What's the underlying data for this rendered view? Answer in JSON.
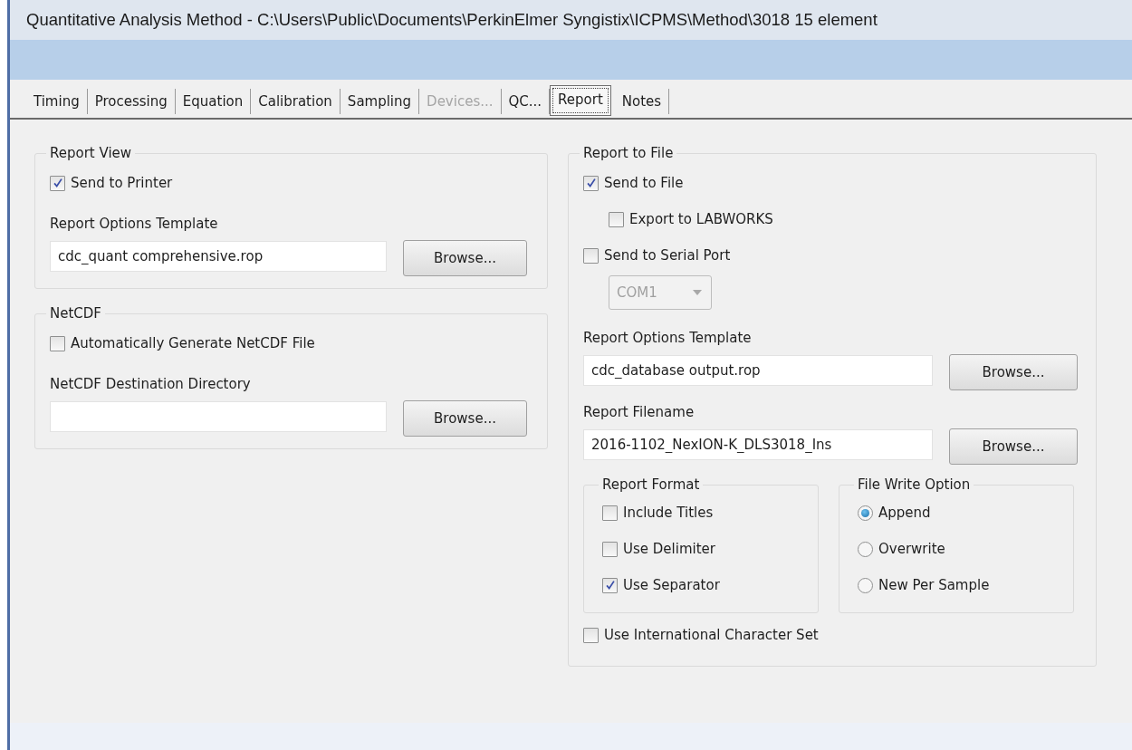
{
  "window": {
    "title": "Quantitative Analysis Method - C:\\Users\\Public\\Documents\\PerkinElmer Syngistix\\ICPMS\\Method\\3018 15 element"
  },
  "tabs": [
    {
      "label": "Timing",
      "selected": false,
      "disabled": false
    },
    {
      "label": "Processing",
      "selected": false,
      "disabled": false
    },
    {
      "label": "Equation",
      "selected": false,
      "disabled": false
    },
    {
      "label": "Calibration",
      "selected": false,
      "disabled": false
    },
    {
      "label": "Sampling",
      "selected": false,
      "disabled": false
    },
    {
      "label": "Devices...",
      "selected": false,
      "disabled": true
    },
    {
      "label": "QC...",
      "selected": false,
      "disabled": false
    },
    {
      "label": "Report",
      "selected": true,
      "disabled": false
    },
    {
      "label": "Notes",
      "selected": false,
      "disabled": false
    }
  ],
  "left_column": [
    {
      "legend": "Report View",
      "items": [
        {
          "kind": "checkbox",
          "label": "Send to Printer",
          "checked": true
        },
        {
          "kind": "label",
          "text": "Report Options Template"
        },
        {
          "kind": "file",
          "value": "cdc_quant comprehensive.rop",
          "button": "Browse..."
        }
      ]
    },
    {
      "legend": "NetCDF",
      "items": [
        {
          "kind": "checkbox",
          "label": "Automatically Generate NetCDF File",
          "checked": false
        },
        {
          "kind": "label",
          "text": "NetCDF Destination Directory"
        },
        {
          "kind": "file",
          "button": "Browse..."
        }
      ]
    }
  ],
  "right_column": [
    {
      "legend": "Report to File",
      "items": [
        {
          "kind": "checkbox",
          "label": "Send to File",
          "checked": true,
          "children": [
            {
              "kind": "checkbox",
              "label": "Export to LABWORKS",
              "checked": false
            }
          ]
        },
        {
          "kind": "checkbox",
          "label": "Send to Serial Port",
          "checked": false,
          "children": [
            {
              "kind": "dropdown",
              "value": "COM1",
              "disabled": true
            }
          ]
        },
        {
          "kind": "label",
          "text": "Report Options Template"
        },
        {
          "kind": "file",
          "value": "cdc_database output.rop",
          "button": "Browse..."
        },
        {
          "kind": "label",
          "text": "Report Filename"
        },
        {
          "kind": "file",
          "value": "2016-1102_NexION-K_DLS3018_Ins",
          "button": "Browse..."
        },
        {
          "kind": "subgroups",
          "groups": [
            {
              "legend": "Report Format",
              "items": [
                {
                  "kind": "checkbox",
                  "label": "Include Titles",
                  "checked": false
                },
                {
                  "kind": "checkbox",
                  "label": "Use Delimiter",
                  "checked": false
                },
                {
                  "kind": "checkbox",
                  "label": "Use Separator",
                  "checked": true
                }
              ]
            },
            {
              "legend": "File Write Option",
              "items": [
                {
                  "kind": "radio",
                  "label": "Append",
                  "selected": true
                },
                {
                  "kind": "radio",
                  "label": "Overwrite",
                  "selected": false
                },
                {
                  "kind": "radio",
                  "label": "New Per Sample",
                  "selected": false
                }
              ]
            }
          ]
        },
        {
          "kind": "checkbox",
          "label": "Use International Character Set",
          "checked": false
        }
      ]
    }
  ]
}
